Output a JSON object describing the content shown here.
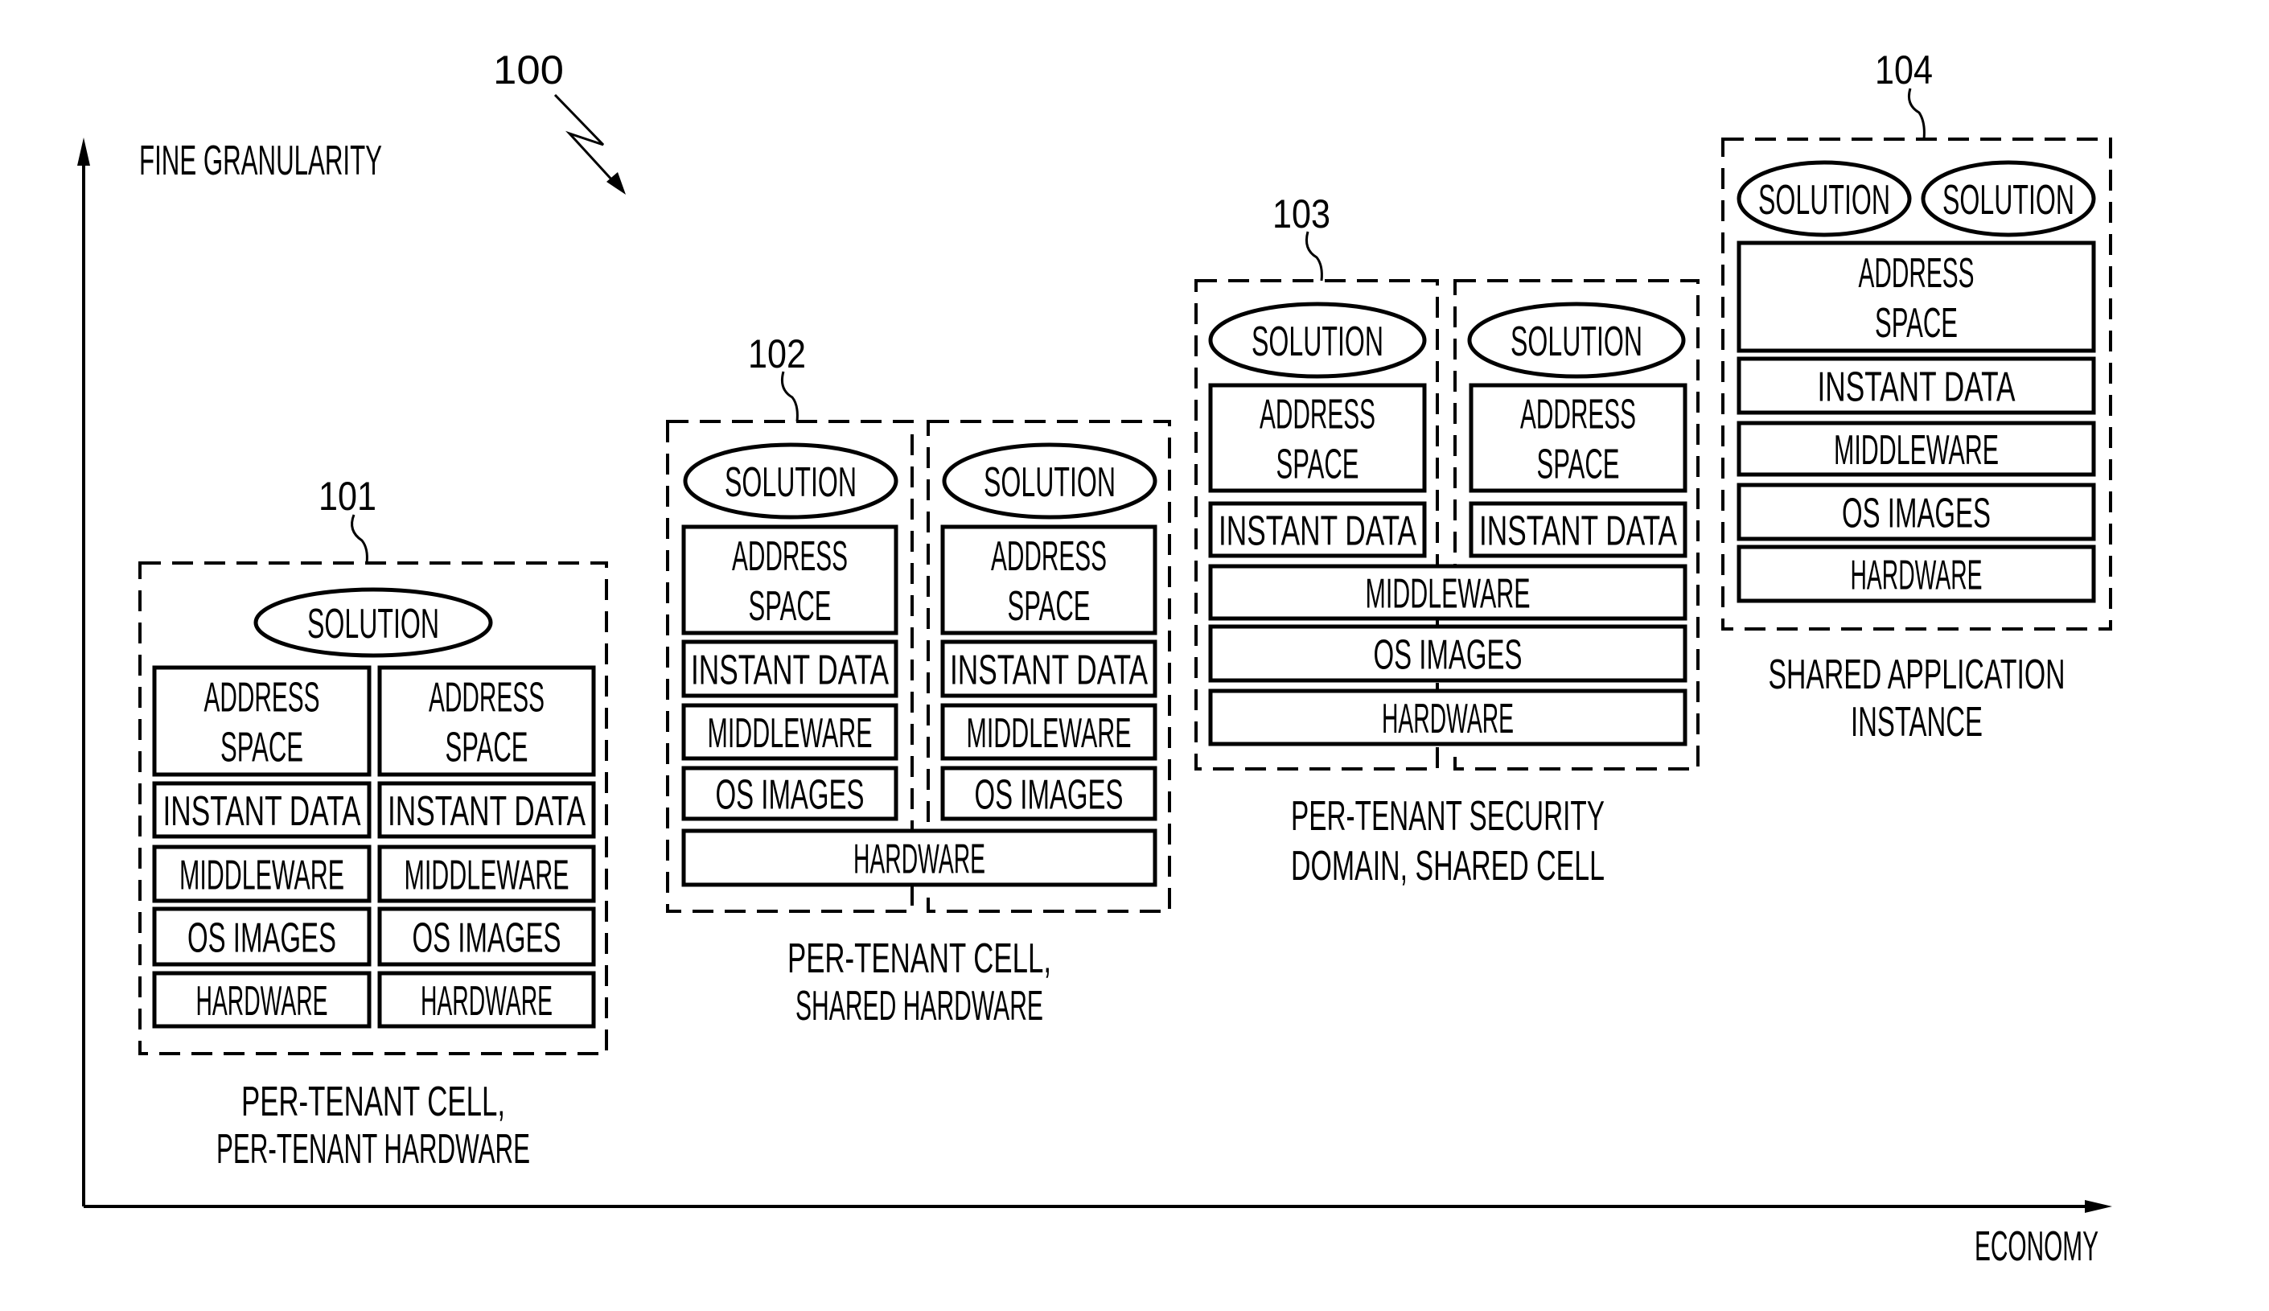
{
  "figure": {
    "reference_number": "100",
    "y_axis_label": "FINE GRANULARITY",
    "x_axis_label": "ECONOMY"
  },
  "colors": {
    "ink": "#000000",
    "background": "#ffffff"
  },
  "panels": [
    {
      "ref": "101",
      "caption": [
        "PER-TENANT CELL,",
        "PER-TENANT HARDWARE"
      ],
      "solutions": [
        "SOLUTION"
      ],
      "layers": {
        "address_space": [
          "ADDRESS",
          "SPACE"
        ],
        "instant_data": "INSTANT DATA",
        "middleware": "MIDDLEWARE",
        "os_images": "OS IMAGES",
        "hardware": "HARDWARE"
      }
    },
    {
      "ref": "102",
      "caption": [
        "PER-TENANT CELL,",
        "SHARED HARDWARE"
      ],
      "solutions": [
        "SOLUTION",
        "SOLUTION"
      ],
      "layers": {
        "address_space": [
          "ADDRESS",
          "SPACE"
        ],
        "instant_data": "INSTANT DATA",
        "middleware": "MIDDLEWARE",
        "os_images": "OS IMAGES",
        "hardware": "HARDWARE"
      }
    },
    {
      "ref": "103",
      "caption": [
        "PER-TENANT SECURITY",
        "DOMAIN, SHARED CELL"
      ],
      "solutions": [
        "SOLUTION",
        "SOLUTION"
      ],
      "layers": {
        "address_space": [
          "ADDRESS",
          "SPACE"
        ],
        "instant_data": "INSTANT DATA",
        "middleware": "MIDDLEWARE",
        "os_images": "OS IMAGES",
        "hardware": "HARDWARE"
      }
    },
    {
      "ref": "104",
      "caption": [
        "SHARED APPLICATION",
        "INSTANCE"
      ],
      "solutions": [
        "SOLUTION",
        "SOLUTION"
      ],
      "layers": {
        "address_space": [
          "ADDRESS",
          "SPACE"
        ],
        "instant_data": "INSTANT DATA",
        "middleware": "MIDDLEWARE",
        "os_images": "OS IMAGES",
        "hardware": "HARDWARE"
      }
    }
  ]
}
